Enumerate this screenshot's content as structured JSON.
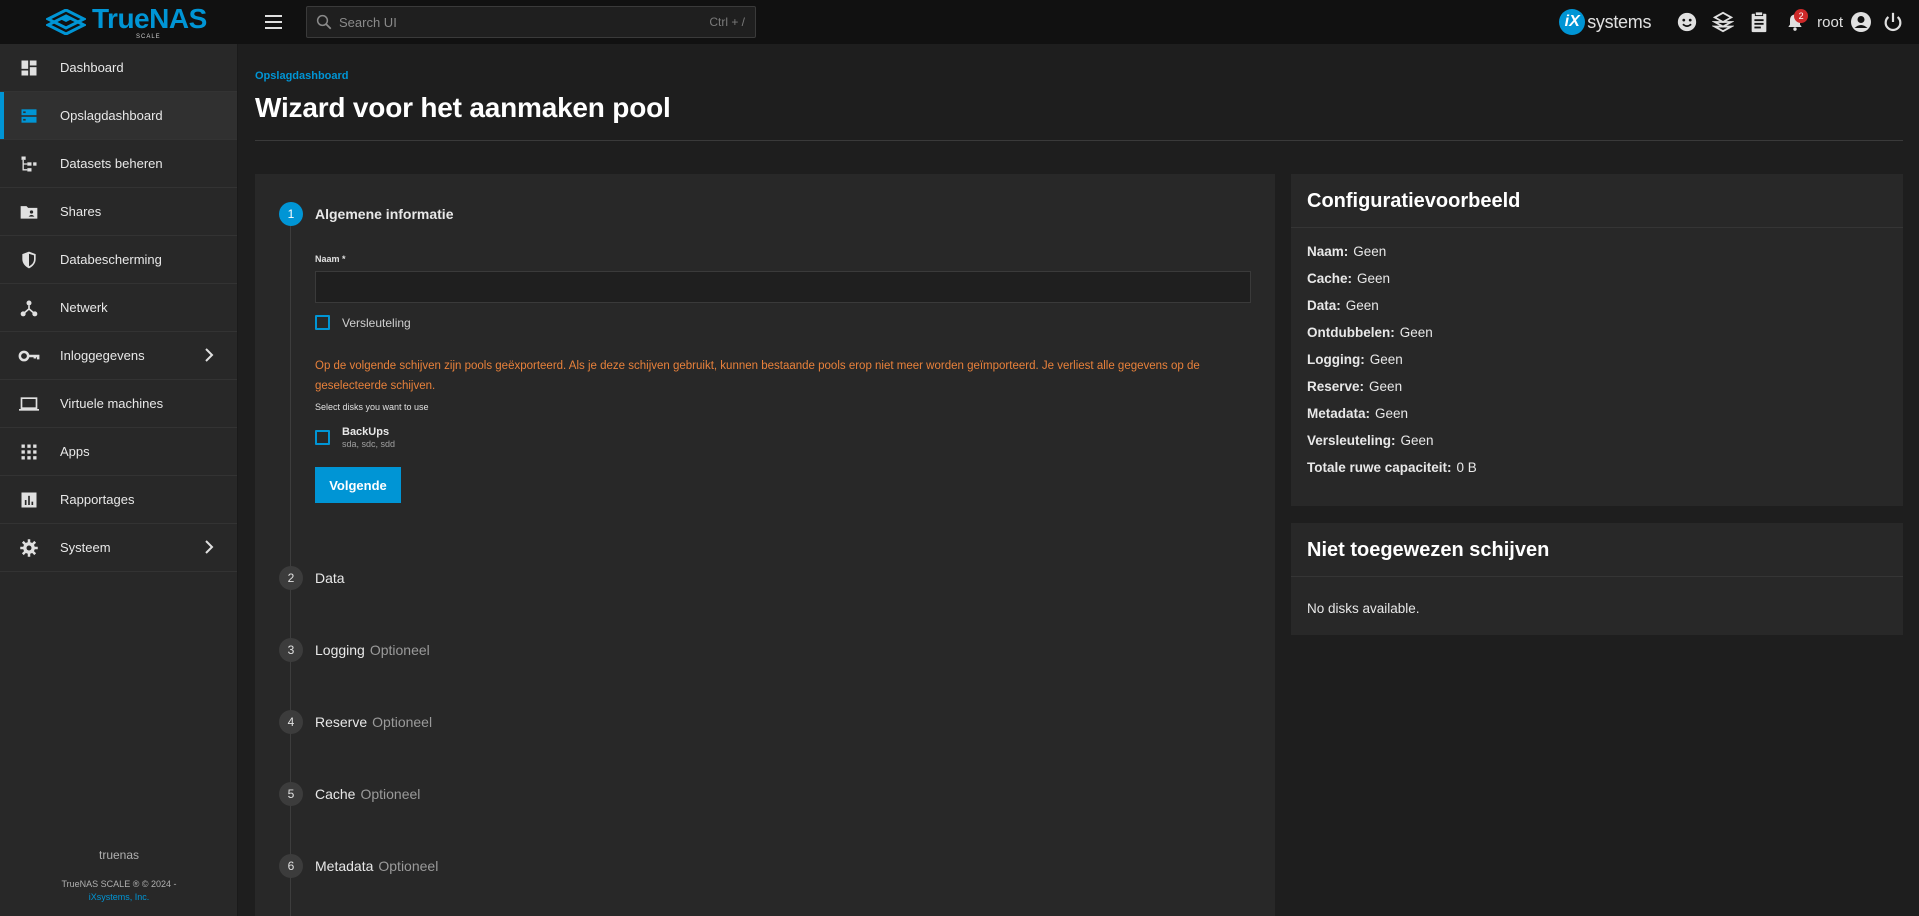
{
  "topbar": {
    "brand_name": "TrueNAS",
    "brand_sub": "SCALE",
    "search_placeholder": "Search UI",
    "search_shortcut": "Ctrl + /",
    "vendor_ix": "iX",
    "vendor_text": "systems",
    "notification_count": "2",
    "user_name": "root"
  },
  "sidebar": {
    "items": [
      {
        "label": "Dashboard",
        "icon": "dashboard-icon"
      },
      {
        "label": "Opslagdashboard",
        "icon": "storage-icon"
      },
      {
        "label": "Datasets beheren",
        "icon": "datasets-icon"
      },
      {
        "label": "Shares",
        "icon": "shares-folder-icon"
      },
      {
        "label": "Databescherming",
        "icon": "shield-icon"
      },
      {
        "label": "Netwerk",
        "icon": "network-icon"
      },
      {
        "label": "Inloggegevens",
        "icon": "key-icon"
      },
      {
        "label": "Virtuele machines",
        "icon": "laptop-icon"
      },
      {
        "label": "Apps",
        "icon": "apps-grid-icon"
      },
      {
        "label": "Rapportages",
        "icon": "reports-icon"
      },
      {
        "label": "Systeem",
        "icon": "gear-icon"
      }
    ],
    "hostname": "truenas",
    "copyright": "TrueNAS SCALE ® © 2024 -",
    "company": "iXsystems, Inc."
  },
  "page": {
    "breadcrumb": "Opslagdashboard",
    "title": "Wizard voor het aanmaken pool"
  },
  "wizard": {
    "steps": [
      {
        "num": "1",
        "label": "Algemene informatie",
        "optional": ""
      },
      {
        "num": "2",
        "label": "Data",
        "optional": ""
      },
      {
        "num": "3",
        "label": "Logging",
        "optional": "Optioneel"
      },
      {
        "num": "4",
        "label": "Reserve",
        "optional": "Optioneel"
      },
      {
        "num": "5",
        "label": "Cache",
        "optional": "Optioneel"
      },
      {
        "num": "6",
        "label": "Metadata",
        "optional": "Optioneel"
      }
    ],
    "name_label": "Naam *",
    "name_value": "",
    "encryption_label": "Versleuteling",
    "warning": "Op de volgende schijven zijn pools geëxporteerd. Als je deze schijven gebruikt, kunnen bestaande pools erop niet meer worden geïmporteerd. Je verliest alle gegevens op de geselecteerde schijven.",
    "disk_hint": "Select disks you want to use",
    "disk_group_name": "BackUps",
    "disk_group_disks": "sda, sdc, sdd",
    "next_button": "Volgende"
  },
  "config_preview": {
    "title": "Configuratievoorbeeld",
    "rows": [
      {
        "key": "Naam:",
        "value": "Geen"
      },
      {
        "key": "Cache:",
        "value": "Geen"
      },
      {
        "key": "Data:",
        "value": "Geen"
      },
      {
        "key": "Ontdubbelen:",
        "value": "Geen"
      },
      {
        "key": "Logging:",
        "value": "Geen"
      },
      {
        "key": "Reserve:",
        "value": "Geen"
      },
      {
        "key": "Metadata:",
        "value": "Geen"
      },
      {
        "key": "Versleuteling:",
        "value": "Geen"
      },
      {
        "key": "Totale ruwe capaciteit:",
        "value": "0 B"
      }
    ]
  },
  "unassigned": {
    "title": "Niet toegewezen schijven",
    "empty_text": "No disks available."
  },
  "colors": {
    "accent": "#0095d5",
    "warning": "#e8813b",
    "badge": "#ce2929"
  }
}
